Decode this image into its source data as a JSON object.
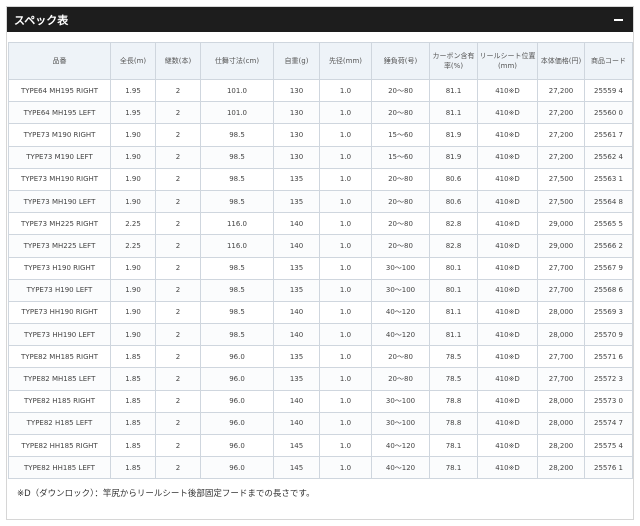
{
  "header": {
    "title": "スペック表"
  },
  "table": {
    "columns": [
      "品番",
      "全長(m)",
      "継数(本)",
      "仕舞寸法(cm)",
      "自重(g)",
      "先径(mm)",
      "錘負荷(号)",
      "カーボン含有率(%)",
      "リールシート位置(mm)",
      "本体価格(円)",
      "商品コード"
    ],
    "rows": [
      [
        "TYPE64 MH195 RIGHT",
        "1.95",
        "2",
        "101.0",
        "130",
        "1.0",
        "20～80",
        "81.1",
        "410※D",
        "27,200",
        "25559 4"
      ],
      [
        "TYPE64 MH195 LEFT",
        "1.95",
        "2",
        "101.0",
        "130",
        "1.0",
        "20～80",
        "81.1",
        "410※D",
        "27,200",
        "25560 0"
      ],
      [
        "TYPE73 M190 RIGHT",
        "1.90",
        "2",
        "98.5",
        "130",
        "1.0",
        "15～60",
        "81.9",
        "410※D",
        "27,200",
        "25561 7"
      ],
      [
        "TYPE73 M190 LEFT",
        "1.90",
        "2",
        "98.5",
        "130",
        "1.0",
        "15～60",
        "81.9",
        "410※D",
        "27,200",
        "25562 4"
      ],
      [
        "TYPE73 MH190 RIGHT",
        "1.90",
        "2",
        "98.5",
        "135",
        "1.0",
        "20～80",
        "80.6",
        "410※D",
        "27,500",
        "25563 1"
      ],
      [
        "TYPE73 MH190 LEFT",
        "1.90",
        "2",
        "98.5",
        "135",
        "1.0",
        "20～80",
        "80.6",
        "410※D",
        "27,500",
        "25564 8"
      ],
      [
        "TYPE73 MH225 RIGHT",
        "2.25",
        "2",
        "116.0",
        "140",
        "1.0",
        "20～80",
        "82.8",
        "410※D",
        "29,000",
        "25565 5"
      ],
      [
        "TYPE73 MH225 LEFT",
        "2.25",
        "2",
        "116.0",
        "140",
        "1.0",
        "20～80",
        "82.8",
        "410※D",
        "29,000",
        "25566 2"
      ],
      [
        "TYPE73 H190 RIGHT",
        "1.90",
        "2",
        "98.5",
        "135",
        "1.0",
        "30～100",
        "80.1",
        "410※D",
        "27,700",
        "25567 9"
      ],
      [
        "TYPE73 H190 LEFT",
        "1.90",
        "2",
        "98.5",
        "135",
        "1.0",
        "30～100",
        "80.1",
        "410※D",
        "27,700",
        "25568 6"
      ],
      [
        "TYPE73 HH190 RIGHT",
        "1.90",
        "2",
        "98.5",
        "140",
        "1.0",
        "40～120",
        "81.1",
        "410※D",
        "28,000",
        "25569 3"
      ],
      [
        "TYPE73 HH190 LEFT",
        "1.90",
        "2",
        "98.5",
        "140",
        "1.0",
        "40～120",
        "81.1",
        "410※D",
        "28,000",
        "25570 9"
      ],
      [
        "TYPE82 MH185 RIGHT",
        "1.85",
        "2",
        "96.0",
        "135",
        "1.0",
        "20～80",
        "78.5",
        "410※D",
        "27,700",
        "25571 6"
      ],
      [
        "TYPE82 MH185 LEFT",
        "1.85",
        "2",
        "96.0",
        "135",
        "1.0",
        "20～80",
        "78.5",
        "410※D",
        "27,700",
        "25572 3"
      ],
      [
        "TYPE82 H185 RIGHT",
        "1.85",
        "2",
        "96.0",
        "140",
        "1.0",
        "30～100",
        "78.8",
        "410※D",
        "28,000",
        "25573 0"
      ],
      [
        "TYPE82 H185 LEFT",
        "1.85",
        "2",
        "96.0",
        "140",
        "1.0",
        "30～100",
        "78.8",
        "410※D",
        "28,000",
        "25574 7"
      ],
      [
        "TYPE82 HH185 RIGHT",
        "1.85",
        "2",
        "96.0",
        "145",
        "1.0",
        "40～120",
        "78.1",
        "410※D",
        "28,200",
        "25575 4"
      ],
      [
        "TYPE82 HH185 LEFT",
        "1.85",
        "2",
        "96.0",
        "145",
        "1.0",
        "40～120",
        "78.1",
        "410※D",
        "28,200",
        "25576 1"
      ]
    ]
  },
  "note": "※D（ダウンロック）：竿尻からリールシート後部固定フードまでの長さです。"
}
